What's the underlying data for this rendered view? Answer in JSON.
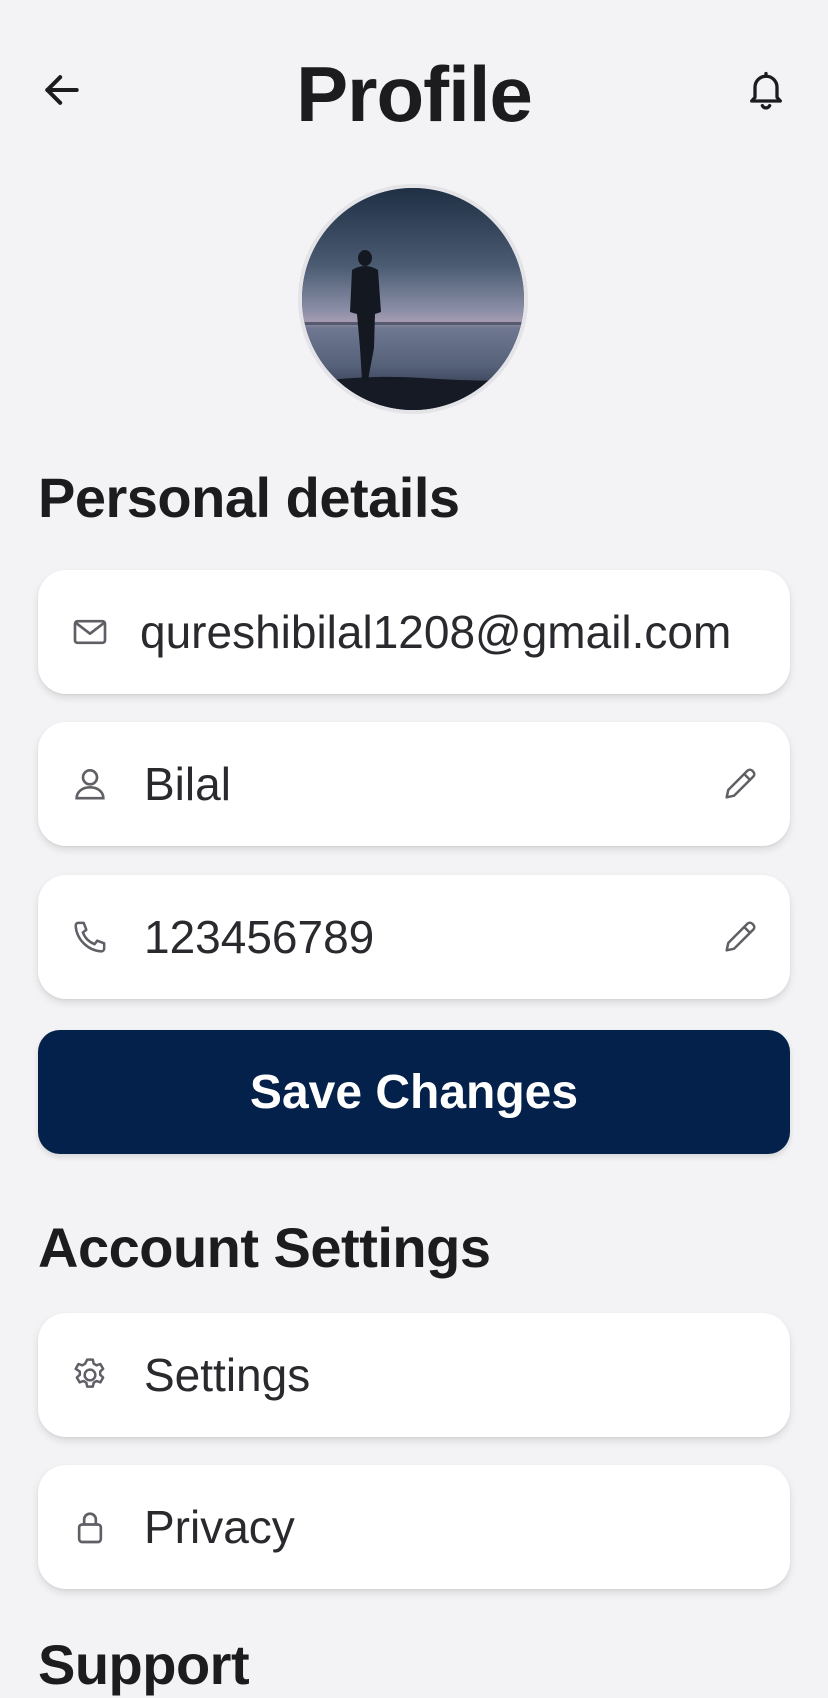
{
  "header": {
    "title": "Profile",
    "back_icon": "arrow-left-icon",
    "notification_icon": "bell-icon"
  },
  "avatar": {
    "description_icon": "profile-photo"
  },
  "personal_details": {
    "title": "Personal details",
    "email": {
      "icon": "mail-icon",
      "value": "qureshibilal1208@gmail.com"
    },
    "name": {
      "icon": "user-icon",
      "value": "Bilal",
      "edit_icon": "pencil-icon"
    },
    "phone": {
      "icon": "phone-icon",
      "value": "123456789",
      "edit_icon": "pencil-icon"
    },
    "save_label": "Save Changes"
  },
  "account_settings": {
    "title": "Account Settings",
    "items": [
      {
        "icon": "gear-icon",
        "label": "Settings"
      },
      {
        "icon": "lock-icon",
        "label": "Privacy"
      }
    ]
  },
  "support": {
    "title": "Support"
  },
  "colors": {
    "background": "#f3f3f5",
    "card": "#ffffff",
    "primary_button": "#03214a",
    "primary_button_text": "#ffffff",
    "text": "#1c1c1e",
    "icon": "#5f5f66"
  }
}
